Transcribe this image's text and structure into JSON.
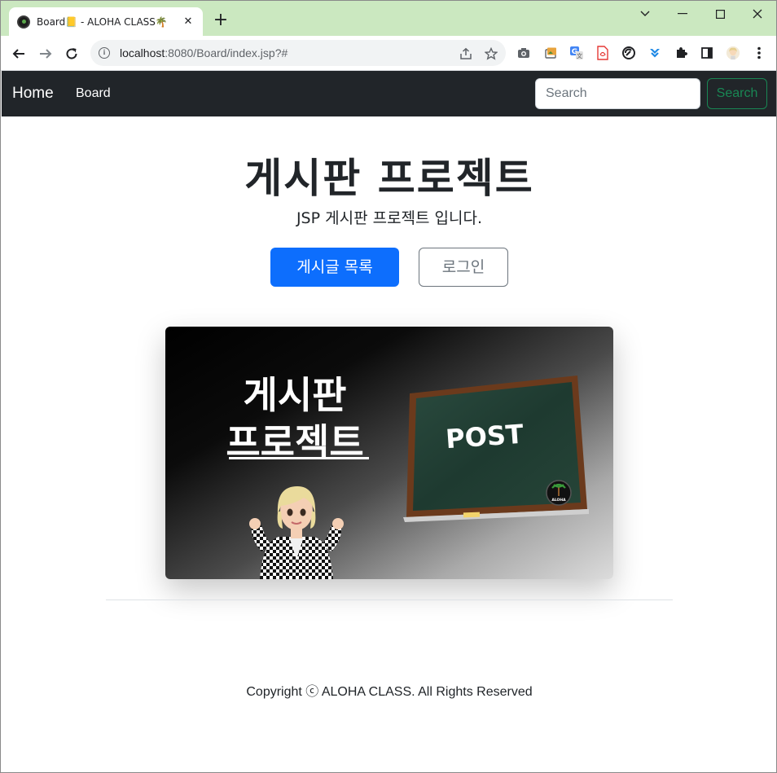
{
  "browser": {
    "tab_title": "Board📒 - ALOHA CLASS🌴",
    "new_tab_symbol": "+",
    "url_host": "localhost",
    "url_rest": ":8080/Board/index.jsp?#"
  },
  "navbar": {
    "brand": "Home",
    "link_board": "Board",
    "search_placeholder": "Search",
    "search_button": "Search"
  },
  "hero": {
    "title": "게시판 프로젝트",
    "subtitle": "JSP 게시판 프로젝트 입니다.",
    "primary_button": "게시글 목록",
    "secondary_button": "로그인"
  },
  "banner": {
    "title_line1": "게시판",
    "title_line2": "프로젝트",
    "board_text": "POST",
    "logo_text": "ALOHA"
  },
  "footer": {
    "copyright": "Copyright ⓒ ALOHA CLASS. All Rights Reserved"
  },
  "colors": {
    "navbar_bg": "#212529",
    "primary": "#0d6efd",
    "success": "#198754",
    "secondary": "#6c757d",
    "titlebar": "#cbe8c0"
  }
}
